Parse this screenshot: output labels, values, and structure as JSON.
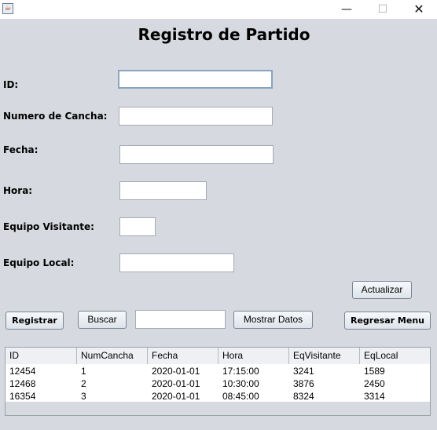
{
  "window": {
    "icon": "java-cup-icon",
    "minimize": "—",
    "maximize": "☐",
    "close": "✕"
  },
  "heading": "Registro de Partido",
  "form": {
    "id_label": "ID:",
    "id_value": "",
    "numero_label": "Numero de Cancha:",
    "numero_value": "",
    "fecha_label": "Fecha:",
    "fecha_value": "",
    "hora_label": "Hora:",
    "hora_value": "",
    "visitante_label": "Equipo Visitante:",
    "visitante_value": "",
    "local_label": "Equipo Local:",
    "local_value": ""
  },
  "buttons": {
    "actualizar": "Actualizar",
    "registrar": "Registrar",
    "buscar": "Buscar",
    "mostrar": "Mostrar Datos",
    "regresar": "Regresar Menu"
  },
  "search_value": "",
  "table": {
    "columns": [
      "ID",
      "NumCancha",
      "Fecha",
      "Hora",
      "EqVisitante",
      "EqLocal"
    ],
    "rows": [
      [
        "12454",
        "1",
        "2020-01-01",
        "17:15:00",
        "3241",
        "1589"
      ],
      [
        "12468",
        "2",
        "2020-01-01",
        "10:30:00",
        "3876",
        "2450"
      ],
      [
        "16354",
        "3",
        "2020-01-01",
        "08:45:00",
        "8324",
        "3314"
      ]
    ]
  }
}
